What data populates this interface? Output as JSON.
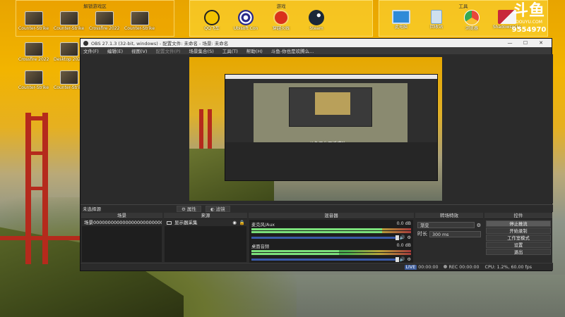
{
  "desktop": {
    "groups": [
      {
        "title": "解锁游戏区"
      },
      {
        "title": "游戏"
      },
      {
        "title": "工具"
      }
    ],
    "icons_left": [
      {
        "label": "Counter-Strike Global Offensive"
      },
      {
        "label": "Counter-Strike Global Offensive"
      },
      {
        "label": "Crossfire 2022-01-19"
      },
      {
        "label": "Counter-Strike Global Offensive"
      },
      {
        "label": "Crossfire 2022-01-19"
      },
      {
        "label": "Desktop 2022.01.19"
      },
      {
        "label": "Counter-Strike Global Offensive"
      },
      {
        "label": "Counter-Strike Global Offensive"
      }
    ],
    "icons_games": [
      {
        "label": "QQ飞车",
        "color": "#f2c200"
      },
      {
        "label": "Ubisoft Con",
        "color": "#2a2a8a"
      },
      {
        "label": "穿越火线",
        "color": "#d9301c"
      },
      {
        "label": "Steam",
        "color": "#1b2838"
      }
    ],
    "icons_tools": [
      {
        "label": "此电脑",
        "color": "#2f8ad8"
      },
      {
        "label": "回收站",
        "color": "#7aa5c8"
      },
      {
        "label": "浏览器",
        "color": "#e8473a"
      },
      {
        "label": "Shadowsocks",
        "color": "#c8283a"
      }
    ],
    "brand": {
      "logo": "斗鱼",
      "sub": "DOUYU.COM",
      "room": "9554970"
    }
  },
  "obs": {
    "title": "OBS 27.1.3 (32-bit, windows) - 配置文件: 未命名 - 场景: 未命名",
    "menu": [
      "文件(F)",
      "编辑(E)",
      "视图(V)",
      "配置文件(P)",
      "场景集合(S)",
      "工具(T)",
      "帮助(H)",
      "斗鱼-你也是欢腾么..."
    ],
    "preview_toast": "斗鱼平台开播成功",
    "no_source": "未选择源",
    "tabs": {
      "props": "属性",
      "filters": "滤镜"
    },
    "scenes": {
      "header": "场景",
      "items": [
        "场景00000000000000000000000000"
      ]
    },
    "sources": {
      "header": "来源",
      "items": [
        "显示器采集"
      ]
    },
    "mixer": {
      "header": "混音器",
      "channels": [
        {
          "name": "麦克风/Aux",
          "db": "0.0 dB",
          "level": 0.82
        },
        {
          "name": "桌面音频",
          "db": "0.0 dB",
          "level": 0.55
        }
      ]
    },
    "transitions": {
      "header": "转场特效",
      "selected": "渐变",
      "duration_label": "时长",
      "duration": "300 ms"
    },
    "controls": {
      "header": "控件",
      "buttons": [
        "停止推流",
        "开始录制",
        "工作室模式",
        "设置",
        "退出"
      ]
    },
    "status": {
      "live_badge": "LIVE",
      "live_time": "00:00:00",
      "rec_label": "REC",
      "rec_time": "00:00:00",
      "cpu": "CPU: 1.2%, 60.00 fps"
    }
  }
}
